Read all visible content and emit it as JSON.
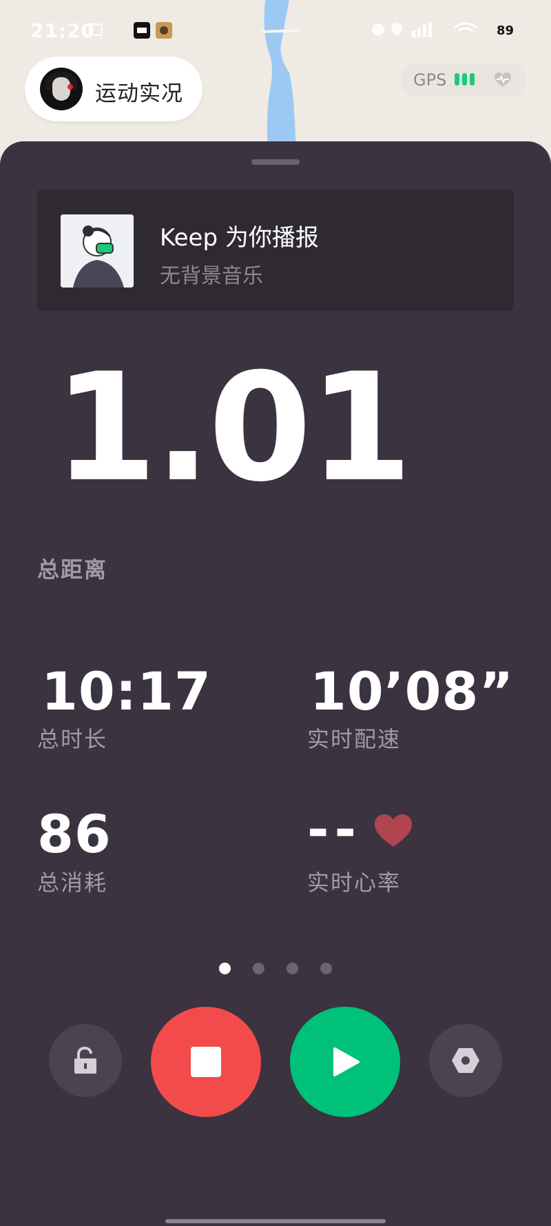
{
  "status_bar": {
    "time": "21:20",
    "battery": "89"
  },
  "header": {
    "title": "运动实况",
    "gps_label": "GPS"
  },
  "music": {
    "title": "Keep 为你播报",
    "subtitle": "无背景音乐"
  },
  "main": {
    "distance_value": "1.01",
    "distance_label": "总距离",
    "duration_value": "10:17",
    "duration_label": "总时长",
    "pace_value": "10’08”",
    "pace_label": "实时配速",
    "calories_value": "86",
    "calories_label": "总消耗",
    "heart_rate_value": "--",
    "heart_rate_label": "实时心率"
  },
  "pager": {
    "total": 4,
    "active": 1
  },
  "controls": [
    "lock-icon",
    "stop-icon",
    "play-icon",
    "settings-icon"
  ],
  "colors": {
    "panel": "#3b3340",
    "stop": "#f34b4b",
    "play": "#00c17a",
    "gps_bars": "#1ec97a",
    "heart": "#b0444f"
  }
}
